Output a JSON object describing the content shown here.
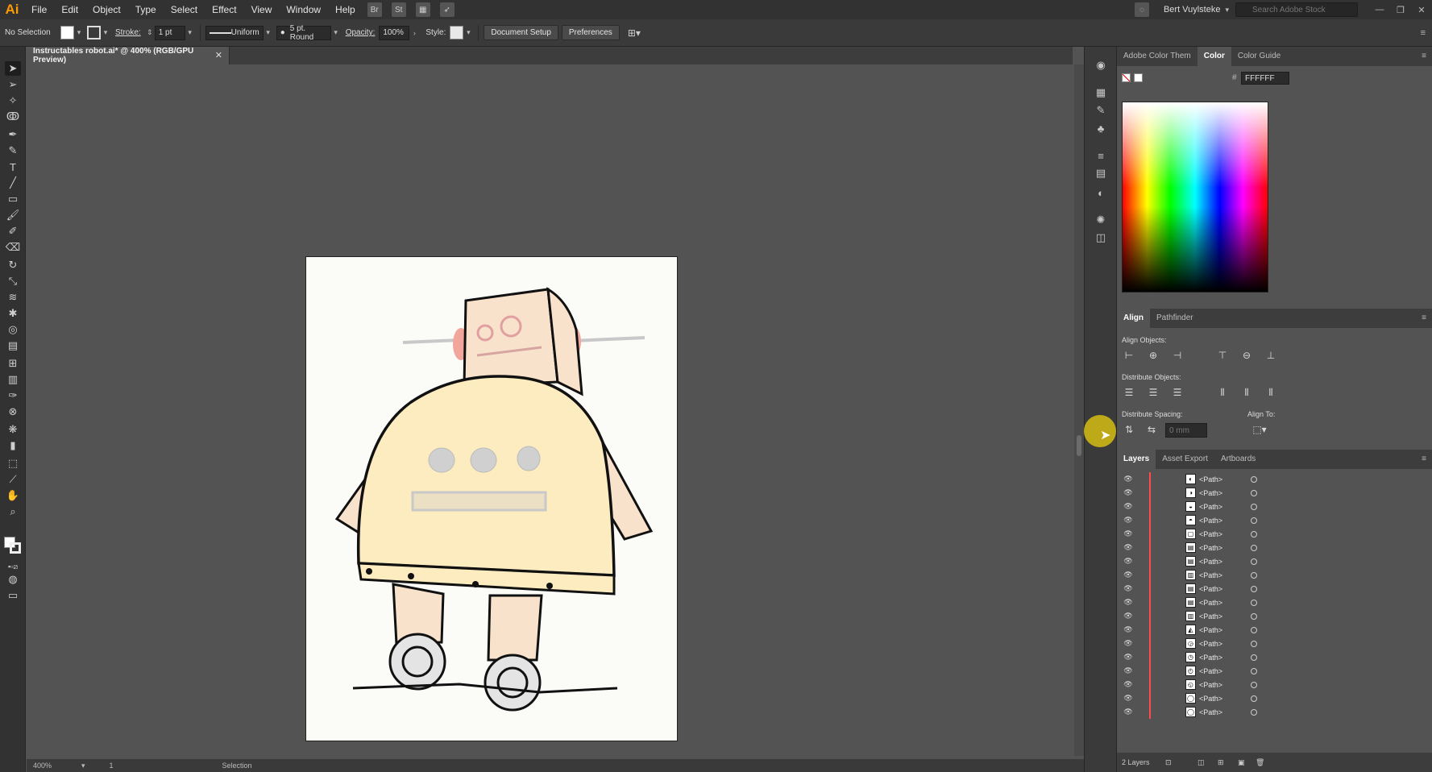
{
  "menubar": {
    "logo": "Ai",
    "items": [
      "File",
      "Edit",
      "Object",
      "Type",
      "Select",
      "Effect",
      "View",
      "Window",
      "Help"
    ],
    "user": "Bert Vuylsteke",
    "search_placeholder": "Search Adobe Stock",
    "st_label": "St"
  },
  "controlbar": {
    "selection_label": "No Selection",
    "stroke_label": "Stroke:",
    "stroke_value": "1 pt",
    "uniform_label": "Uniform",
    "brush_label": "5 pt. Round",
    "opacity_label": "Opacity:",
    "opacity_value": "100%",
    "style_label": "Style:",
    "document_setup": "Document Setup",
    "preferences": "Preferences"
  },
  "document": {
    "tab_title": "Instructables robot.ai* @ 400% (RGB/GPU Preview)"
  },
  "statusbar": {
    "zoom": "400%",
    "page": "1",
    "tool": "Selection"
  },
  "color_panel": {
    "tabs": [
      "Adobe Color Them",
      "Color",
      "Color Guide"
    ],
    "active_tab": "Color",
    "hex_value": "FFFFFF",
    "hash": "#"
  },
  "align_panel": {
    "tabs": [
      "Align",
      "Pathfinder"
    ],
    "align_objects": "Align Objects:",
    "distribute_objects": "Distribute Objects:",
    "distribute_spacing": "Distribute Spacing:",
    "align_to": "Align To:",
    "spacing_value": "0 mm"
  },
  "layers_panel": {
    "tabs": [
      "Layers",
      "Asset Export",
      "Artboards"
    ],
    "rows": [
      "<Path>",
      "<Path>",
      "<Path>",
      "<Path>",
      "<Path>",
      "<Path>",
      "<Path>",
      "<Path>",
      "<Path>",
      "<Path>",
      "<Path>",
      "<Path>",
      "<Path>",
      "<Path>",
      "<Path>",
      "<Path>",
      "<Path>",
      "<Path>"
    ],
    "footer": "2 Layers"
  },
  "colors": {
    "robot_fill": "#fdecc0",
    "robot_head": "#f9e2cc",
    "ear": "#f2a59a",
    "outline": "#111111",
    "accent": "#ff9a00",
    "layer_color": "#ff4b4b"
  }
}
